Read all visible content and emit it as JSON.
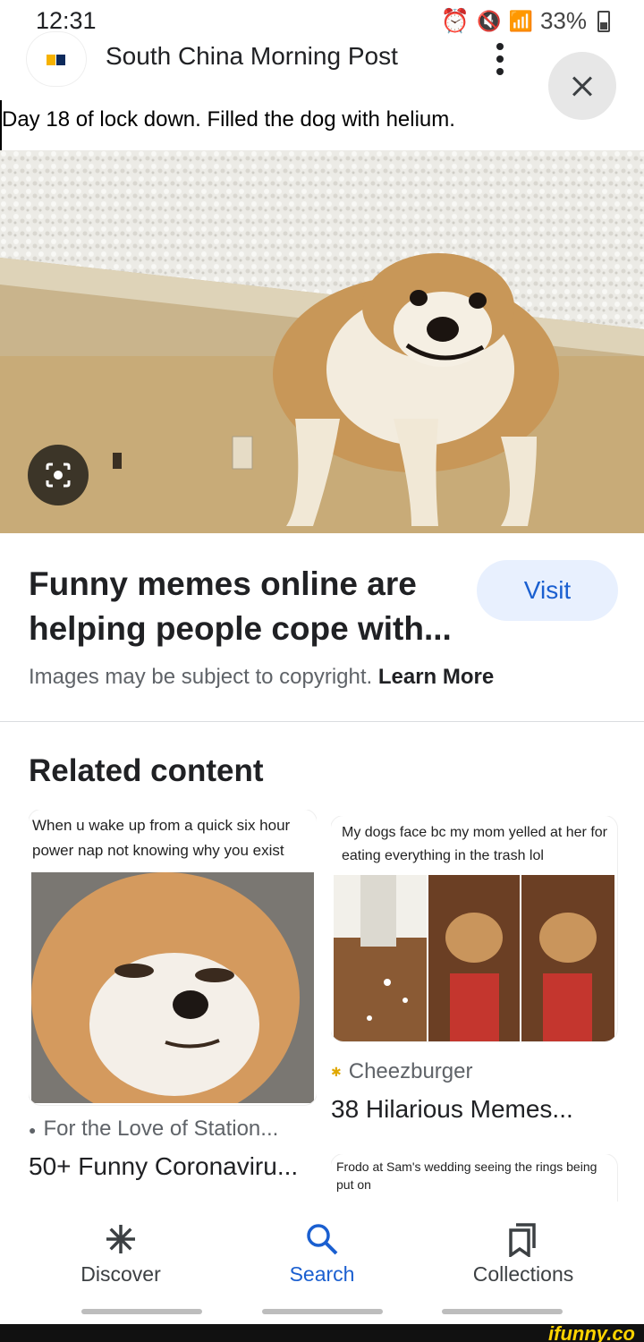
{
  "status_bar": {
    "time": "12:31",
    "battery": "33%"
  },
  "source": {
    "name": "South China Morning Post"
  },
  "image": {
    "caption": "Day 18 of lock down. Filled the dog with helium."
  },
  "result": {
    "title": "Funny memes online are helping people cope with...",
    "visit_label": "Visit",
    "copyright_text": "Images may be subject to copyright.",
    "learn_more": "Learn More"
  },
  "related": {
    "heading": "Related content",
    "cards": [
      {
        "meme_text": "When u wake up from a quick six hour power nap not knowing why you exist",
        "source": "For the Love of Station...",
        "title": "50+ Funny Coronaviru..."
      },
      {
        "meme_text": "My dogs face bc my mom yelled at her for eating everything in the trash lol",
        "source": "Cheezburger",
        "title": "38 Hilarious Memes..."
      },
      {
        "meme_text": "Frodo at Sam's wedding seeing the rings being put on"
      }
    ]
  },
  "bottom_nav": {
    "items": [
      {
        "label": "Discover",
        "icon": "discover-icon"
      },
      {
        "label": "Search",
        "icon": "search-icon"
      },
      {
        "label": "Collections",
        "icon": "collections-icon"
      }
    ]
  },
  "footer": {
    "watermark": "ifunny.co"
  },
  "colors": {
    "accent": "#1a5fd0",
    "visit_bg": "#e8f0fe"
  }
}
